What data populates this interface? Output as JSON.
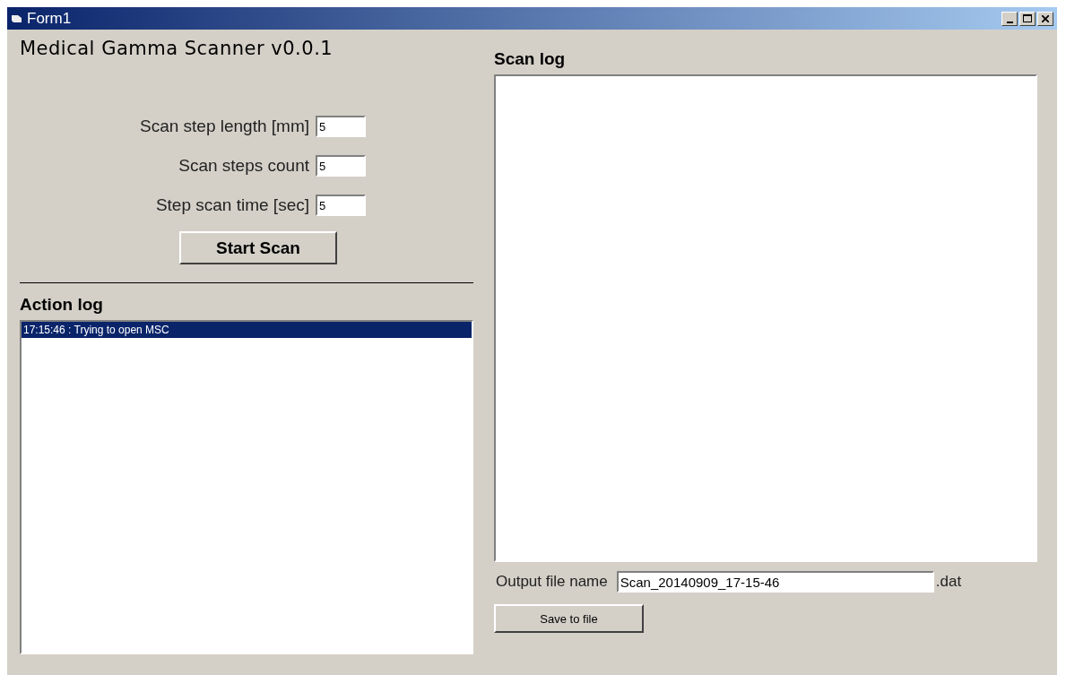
{
  "window": {
    "title": "Form1"
  },
  "app_title": "Medical Gamma Scanner v0.0.1",
  "fields": [
    {
      "label": "Scan step length [mm]",
      "value": "5"
    },
    {
      "label": "Scan steps count",
      "value": "5"
    },
    {
      "label": "Step scan time [sec]",
      "value": "5"
    }
  ],
  "start_button": "Start Scan",
  "action_log": {
    "title": "Action log",
    "items": [
      {
        "text": "17:15:46 : Trying to open MSC",
        "selected": true
      }
    ]
  },
  "scan_log": {
    "title": "Scan log"
  },
  "output": {
    "label": "Output file name",
    "value": "Scan_20140909_17-15-46",
    "suffix": ".dat"
  },
  "save_button": "Save to file"
}
